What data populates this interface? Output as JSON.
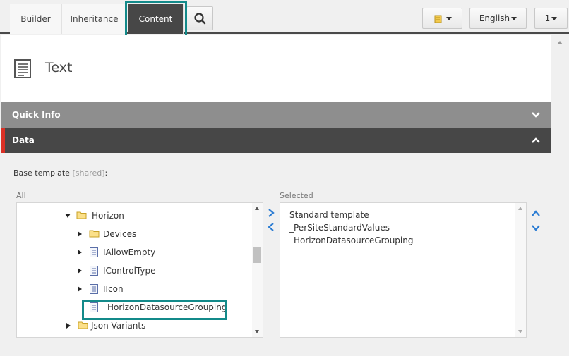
{
  "tabs": {
    "builder": "Builder",
    "inheritance": "Inheritance",
    "content": "Content"
  },
  "toolbar": {
    "language": "English",
    "version": "1"
  },
  "header": {
    "title": "Text"
  },
  "sections": {
    "quick_info": "Quick Info",
    "data": "Data"
  },
  "field": {
    "label": "Base template",
    "shared": "[shared]",
    "colon": ":",
    "all_label": "All",
    "selected_label": "Selected"
  },
  "tree": [
    {
      "label": "Horizon",
      "icon": "folder-icon",
      "state": "expanded"
    },
    {
      "label": "Devices",
      "icon": "folder-icon",
      "state": "collapsed"
    },
    {
      "label": "IAllowEmpty",
      "icon": "template-icon",
      "state": "collapsed"
    },
    {
      "label": "IControlType",
      "icon": "template-icon",
      "state": "collapsed"
    },
    {
      "label": "IIcon",
      "icon": "template-icon",
      "state": "collapsed"
    },
    {
      "label": "_HorizonDatasourceGrouping",
      "icon": "template-icon",
      "state": "leaf"
    },
    {
      "label": "Json Variants",
      "icon": "folder-icon",
      "state": "collapsed"
    }
  ],
  "selected": [
    "Standard template",
    "_PerSiteStandardValues",
    "_HorizonDatasourceGrouping"
  ],
  "colors": {
    "accent_teal": "#138a8a",
    "active_tab": "#474747",
    "section_gray": "#8e8e8e",
    "data_accent_red": "#d93025",
    "arrow_blue": "#2b7cd3",
    "folder_yellow": "#f2c94c"
  }
}
